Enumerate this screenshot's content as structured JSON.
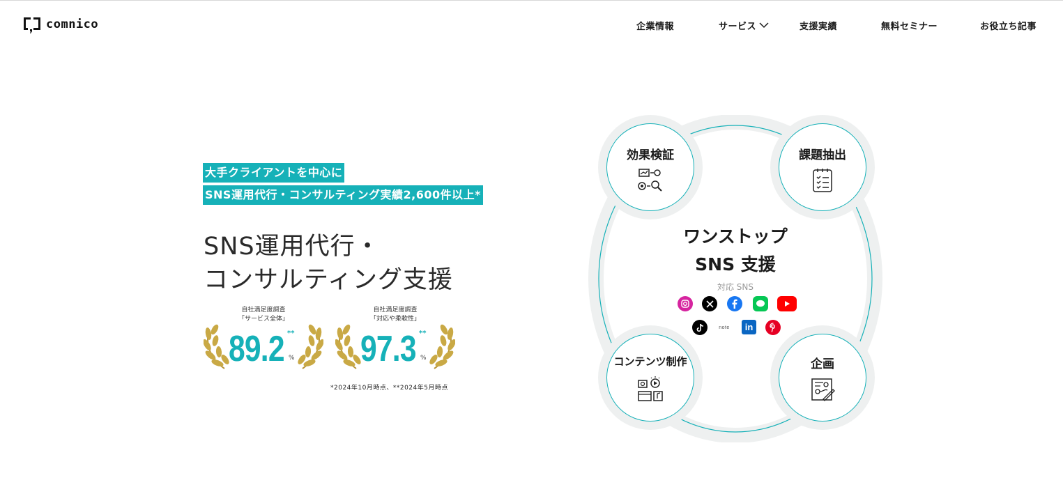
{
  "header": {
    "logo_text": "comnico",
    "nav": [
      {
        "label": "企業情報"
      },
      {
        "label": "サービス"
      },
      {
        "label": "支援実績"
      },
      {
        "label": "無料セミナー"
      },
      {
        "label": "お役立ち記事"
      }
    ]
  },
  "hero": {
    "tag_line1": "大手クライアントを中心に",
    "tag_line2": "SNS運用代行・コンサルティング実績2,600件以上*",
    "headline_line1": "SNS運用代行・",
    "headline_line2": "コンサルティング支援",
    "awards": [
      {
        "label1": "自社満足度調査",
        "label2": "「サービス全体」",
        "value": "89.2",
        "stars": "**",
        "unit": "%"
      },
      {
        "label1": "自社満足度調査",
        "label2": "「対応や柔軟性」",
        "value": "97.3",
        "stars": "**",
        "unit": "%"
      }
    ],
    "footnote": "*2024年10月時点、**2024年5月時点"
  },
  "diagram": {
    "center_line1": "ワンストップ",
    "center_line2": "SNS 支援",
    "sns_label": "対応 SNS",
    "nodes": {
      "effect": "効果検証",
      "issue": "課題抽出",
      "content": "コンテンツ制作",
      "plan": "企画"
    },
    "sns_icons": [
      "instagram-icon",
      "x-icon",
      "facebook-icon",
      "line-icon",
      "youtube-icon",
      "tiktok-icon",
      "note-icon",
      "linkedin-icon",
      "pinterest-icon"
    ],
    "note_text": "note",
    "linkedin_text": "in"
  },
  "colors": {
    "accent": "#16b1b8",
    "gold": "#c9a945",
    "node_bg": "#eef0f0"
  }
}
